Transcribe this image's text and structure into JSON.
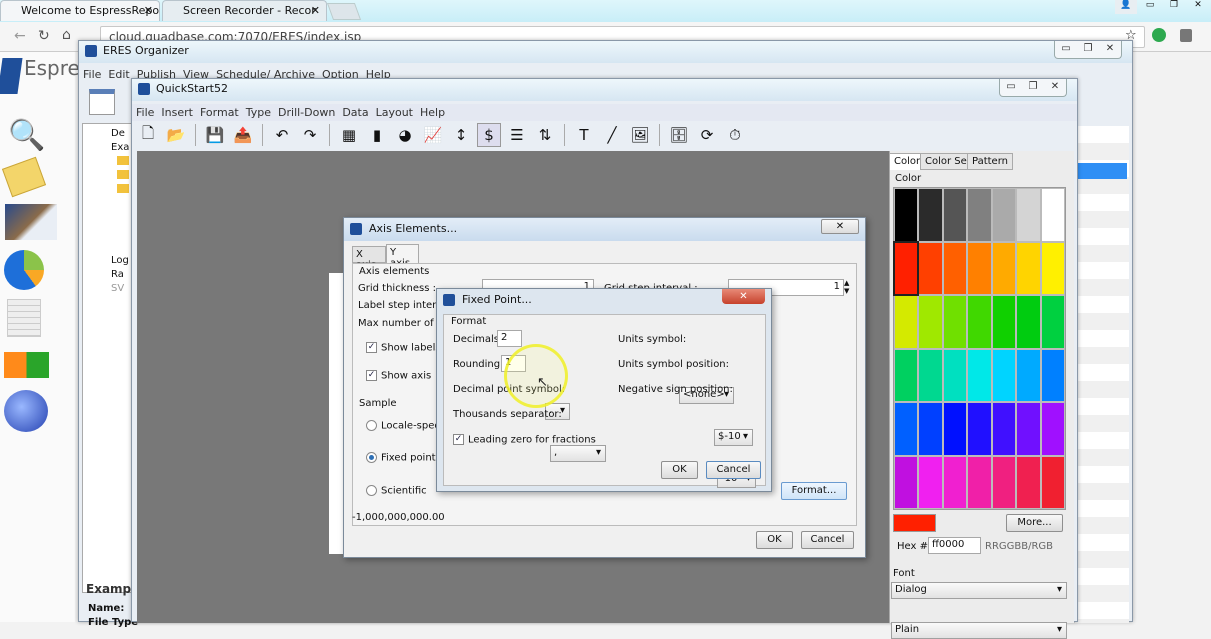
{
  "browser": {
    "tabs": [
      {
        "label": "Welcome to EspressRepo"
      },
      {
        "label": "Screen Recorder - Recor"
      }
    ],
    "url": "cloud.quadbase.com:7070/ERES/index.jsp",
    "site_title": "Espre"
  },
  "organizer": {
    "title": "ERES Organizer",
    "menu": [
      "File",
      "Edit",
      "Publish",
      "View",
      "Schedule/ Archive",
      "Option",
      "Help"
    ],
    "tree": [
      "De",
      "Exa",
      "Log",
      "Ra",
      "SV"
    ],
    "details_title": "Exampl",
    "name_label": "Name:",
    "filetype_label": "File Type"
  },
  "quickstart": {
    "title": "QuickStart52",
    "menu": [
      "File",
      "Insert",
      "Format",
      "Type",
      "Drill-Down",
      "Data",
      "Layout",
      "Help"
    ],
    "toolbar": [
      "new-file-icon",
      "open-folder-icon",
      "save-icon",
      "export-icon",
      "undo-icon",
      "redo-icon",
      "data-table-icon",
      "chart-type-icon",
      "pie-color-icon",
      "line-chart-icon",
      "axis-scale-icon",
      "number-format-icon",
      "list-icon",
      "sort-az-icon",
      "text-icon",
      "line-draw-icon",
      "image-icon",
      "database-icon",
      "refresh-icon",
      "schedule-icon"
    ]
  },
  "color_panel": {
    "tabs": [
      "Color",
      "Color Set",
      "Pattern"
    ],
    "section": "Color",
    "colors": [
      "#000000",
      "#2b2b2b",
      "#555555",
      "#808080",
      "#aaaaaa",
      "#d4d4d4",
      "#ffffff",
      "#ff2000",
      "#ff4000",
      "#ff6000",
      "#ff8000",
      "#ffaa00",
      "#ffd400",
      "#fff000",
      "#d4ea00",
      "#a0e800",
      "#70e000",
      "#40d800",
      "#10d000",
      "#00cc10",
      "#00d040",
      "#00d060",
      "#00d890",
      "#00e0c0",
      "#00e8e8",
      "#00d4ff",
      "#00aaff",
      "#0080ff",
      "#0060ff",
      "#0040ff",
      "#0010ff",
      "#2010ff",
      "#4010ff",
      "#7010ff",
      "#a010ff",
      "#c010e0",
      "#f020f0",
      "#f020d0",
      "#f020a8",
      "#f02080",
      "#f02050",
      "#f02030"
    ],
    "selected_color": "#ff2000",
    "more_label": "More...",
    "hex_label": "Hex #",
    "hex_value": "ff0000",
    "hex_hint": "RRGGBB/RGB",
    "font_label": "Font",
    "font_value": "Dialog",
    "style_value": "Plain"
  },
  "axis_dialog": {
    "title": "Axis Elements...",
    "tabs": [
      "X axis",
      "Y axis"
    ],
    "active_tab": "Y axis",
    "section": "Axis elements",
    "grid_thickness_label": "Grid thickness :",
    "grid_thickness_value": "1",
    "grid_step_label": "Grid step interval :",
    "grid_step_value": "1",
    "label_step_label": "Label step interval",
    "max_labels_label": "Max number of labe",
    "show_labels": "Show labels",
    "show_axis": "Show axis",
    "sample_label": "Sample",
    "radio": [
      "Locale-specific",
      "Fixed point",
      "Scientific"
    ],
    "selected_radio": "Fixed point",
    "format_button": "Format...",
    "sample_value": "-1,000,000,000.00",
    "ok": "OK",
    "cancel": "Cancel"
  },
  "fixed_dialog": {
    "title": "Fixed Point...",
    "section": "Format",
    "decimals_label": "Decimals:",
    "decimals_value": "2",
    "rounding_label": "Rounding:",
    "rounding_value": "1",
    "decimal_symbol_label": "Decimal point symbol:",
    "decimal_symbol_value": ".",
    "thousands_label": "Thousands separator:",
    "thousands_value": ",",
    "leading_zero_label": "Leading zero for fractions",
    "leading_zero_checked": true,
    "units_label": "Units symbol:",
    "units_value": "<none>",
    "units_pos_label": "Units symbol position:",
    "units_pos_value": "$-10",
    "neg_label": "Negative sign position:",
    "neg_value": "-10",
    "ok": "OK",
    "cancel": "Cancel"
  }
}
